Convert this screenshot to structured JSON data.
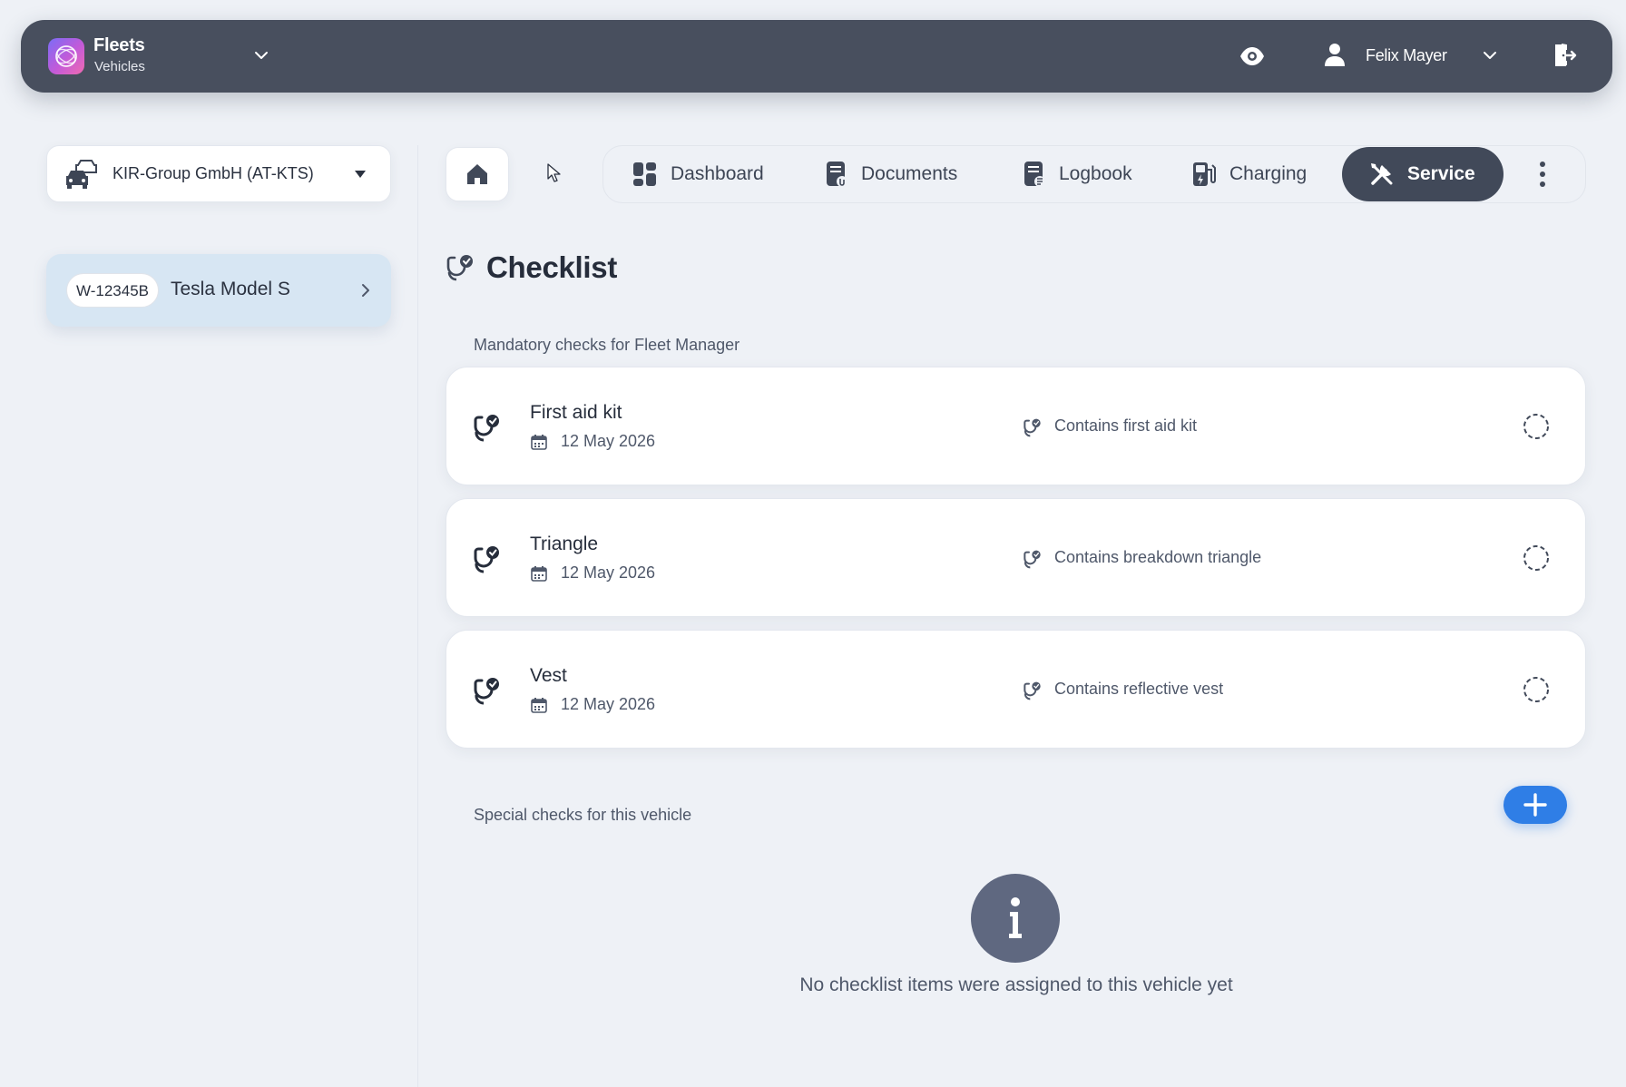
{
  "app": {
    "name": "Fleets",
    "module": "Vehicles"
  },
  "user": {
    "name": "Felix Mayer"
  },
  "company": {
    "selected": "KIR-Group GmbH (AT-KTS)"
  },
  "vehicle": {
    "plate": "W-12345B",
    "model": "Tesla Model S"
  },
  "tabs": [
    {
      "label": "Dashboard",
      "icon": "dashboard-icon",
      "active": false
    },
    {
      "label": "Documents",
      "icon": "documents-icon",
      "active": false
    },
    {
      "label": "Logbook",
      "icon": "logbook-icon",
      "active": false
    },
    {
      "label": "Charging",
      "icon": "charging-icon",
      "active": false
    },
    {
      "label": "Service",
      "icon": "service-icon",
      "active": true
    }
  ],
  "page": {
    "title": "Checklist"
  },
  "mandatory": {
    "label": "Mandatory checks for Fleet Manager",
    "items": [
      {
        "title": "First aid kit",
        "date": "12 May 2026",
        "requirement": "Contains first aid kit"
      },
      {
        "title": "Triangle",
        "date": "12 May 2026",
        "requirement": "Contains breakdown triangle"
      },
      {
        "title": "Vest",
        "date": "12 May 2026",
        "requirement": "Contains reflective vest"
      }
    ]
  },
  "special": {
    "label": "Special checks for this vehicle",
    "empty_text": "No checklist items were assigned to this vehicle yet"
  },
  "colors": {
    "topbar": "#484f5e",
    "active_tab": "#414959",
    "accent": "#2f7ee6",
    "selected_vehicle": "#d7e6f3"
  }
}
